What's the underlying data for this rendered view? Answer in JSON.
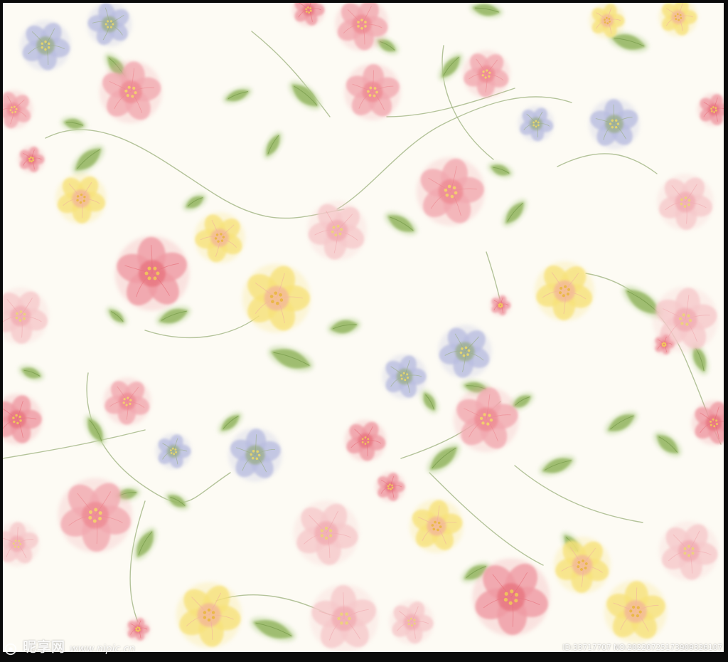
{
  "image": {
    "subject": "seamless watercolor floral pattern",
    "colors": {
      "background": "#fdfbf4",
      "frame": "#0b0b0b",
      "pink_petal": "#f2a9b0",
      "deep_pink": "#ec7d86",
      "yellow_petal": "#f7e27a",
      "lavender_petal": "#b9bde0",
      "leaf_green": "#8fb25a",
      "pale_leaf": "#cfe0b4",
      "stem": "#9bb07c"
    }
  },
  "watermark": {
    "brand": "昵享网",
    "url": "www.nipic.cn",
    "id_text": "ID:33717707 NO:20220725173909326107"
  }
}
